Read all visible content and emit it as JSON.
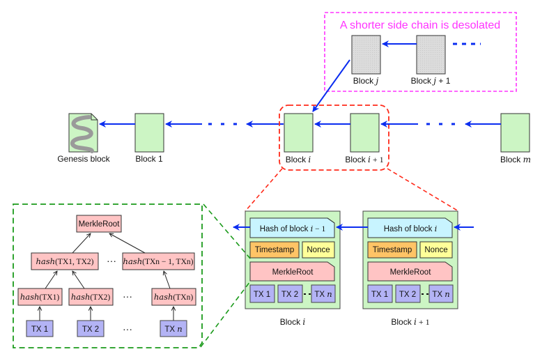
{
  "side_chain": {
    "title": "A shorter side chain is desolated",
    "title_color": "#ff33ff",
    "blocks": [
      {
        "prefix": "Block ",
        "var": "j",
        "suffix": ""
      },
      {
        "prefix": "Block ",
        "var": "j",
        "suffix": " + 1"
      }
    ],
    "ellipsis": "• • •"
  },
  "main_chain": {
    "genesis_label": "Genesis block",
    "blocks": [
      {
        "prefix": "Block 1",
        "var": "",
        "suffix": ""
      },
      {
        "prefix": "Block ",
        "var": "i",
        "suffix": ""
      },
      {
        "prefix": "Block ",
        "var": "i",
        "suffix": " + 1"
      },
      {
        "prefix": "Block ",
        "var": "m",
        "suffix": ""
      }
    ]
  },
  "block_detail": {
    "blocks": [
      {
        "hash_prefix": "Hash of block ",
        "hash_var": "i",
        "hash_suffix": " − 1",
        "timestamp": "Timestamp",
        "nonce": "Nonce",
        "merkle_root": "MerkleRoot",
        "tx1": "TX 1",
        "tx2": "TX 2",
        "txn_prefix": "TX ",
        "txn_var": "n",
        "caption_prefix": "Block ",
        "caption_var": "i",
        "caption_suffix": ""
      },
      {
        "hash_prefix": "Hash of block ",
        "hash_var": "i",
        "hash_suffix": "",
        "timestamp": "Timestamp",
        "nonce": "Nonce",
        "merkle_root": "MerkleRoot",
        "tx1": "TX 1",
        "tx2": "TX 2",
        "txn_prefix": "TX ",
        "txn_var": "n",
        "caption_prefix": "Block ",
        "caption_var": "i",
        "caption_suffix": " + 1"
      }
    ]
  },
  "merkle_tree": {
    "root": "MerkleRoot",
    "level2": [
      {
        "fn": "hash",
        "args": "(TX1, TX2)"
      },
      {
        "fn": "hash",
        "args": "(TXn − 1, TXn)"
      }
    ],
    "level1": [
      {
        "fn": "hash",
        "args": "(TX1)"
      },
      {
        "fn": "hash",
        "args": "(TX2)"
      },
      {
        "fn": "hash",
        "args": "(TXn)"
      }
    ],
    "leaves": [
      {
        "prefix": "TX 1",
        "var": ""
      },
      {
        "prefix": "TX 2",
        "var": ""
      },
      {
        "prefix": "TX ",
        "var": "n"
      }
    ],
    "ellipsis": "···"
  },
  "colors": {
    "block_green": "#ccf5c4",
    "block_gray": "#d8d8d8",
    "arrow_blue": "#0a2cf0",
    "hash_cyan": "#c8f4ff",
    "timestamp_orange": "#ffc466",
    "nonce_yellow": "#ffff99",
    "merkle_pink": "#ffc4c4",
    "tx_purple": "#b3b3f5",
    "red_dash": "#ff2a1a",
    "green_dash": "#1a9a1a",
    "magenta_dash": "#ff33ff"
  }
}
